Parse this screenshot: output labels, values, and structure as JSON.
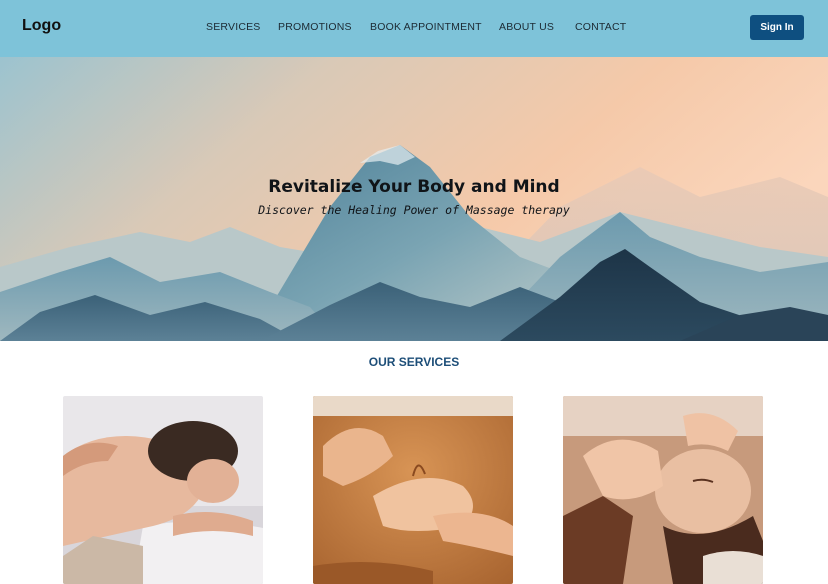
{
  "header": {
    "logo": "Logo",
    "nav": [
      "SERVICES",
      "PROMOTIONS",
      "BOOK APPOINTMENT",
      "ABOUT US",
      "CONTACT"
    ],
    "sign_in_label": "Sign In",
    "background_color": "#7ec3d9",
    "button_color": "#0e4f80"
  },
  "hero": {
    "title": "Revitalize Your Body and Mind",
    "subtitle": "Discover the Healing Power of Massage therapy",
    "image": "mountain-landscape-image"
  },
  "services": {
    "title": "OUR SERVICES",
    "accent_color": "#1d4e78",
    "cards": [
      {
        "image": "back-shoulder-massage-image"
      },
      {
        "image": "back-massage-closeup-image"
      },
      {
        "image": "facial-head-massage-image"
      }
    ]
  }
}
